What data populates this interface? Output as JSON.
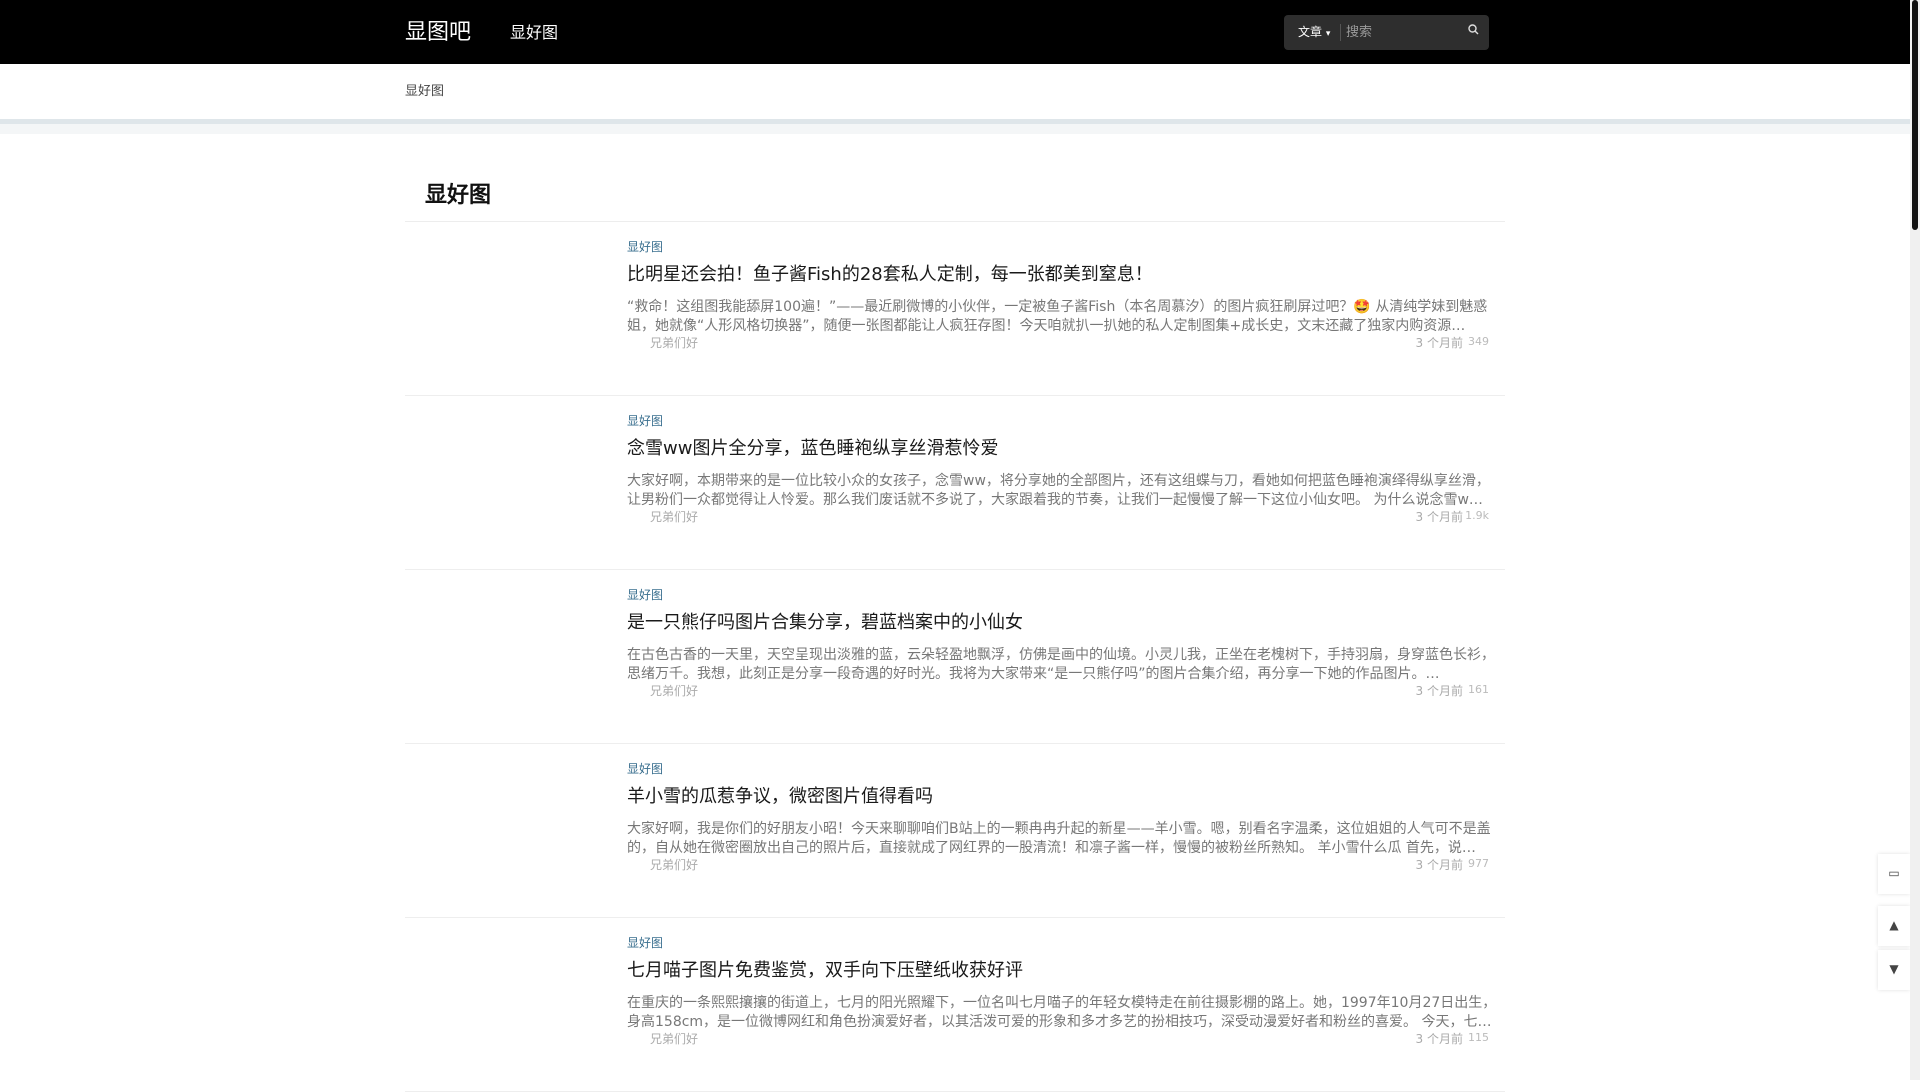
{
  "header": {
    "logo": "显图吧",
    "nav": [
      "显好图"
    ],
    "search": {
      "type_label": "文章",
      "type_icon": "chevron-down-icon",
      "placeholder": "搜索",
      "button_icon": "search-icon"
    }
  },
  "breadcrumb": "显好图",
  "section_title": "显好图",
  "posts": [
    {
      "category": "显好图",
      "title": "比明星还会拍！鱼子酱Fish的28套私人定制，每一张都美到窒息！",
      "excerpt": "“救命！这组图我能舔屏100遍！”——最近刷微博的小伙伴，一定被鱼子酱Fish（本名周慕汐）的图片疯狂刷屏过吧？🤩 从清纯学妹到魅惑姐，她就像“人形风格切换器”，随便一张图都能让人疯狂存图！今天咱就扒一扒她的私人定制图集+成长史，文末还藏了独家内购资源…",
      "author": "兄弟们好",
      "time": "3 个月前",
      "views": "349"
    },
    {
      "category": "显好图",
      "title": "念雪ww图片全分享，蓝色睡袍纵享丝滑惹怜爱",
      "excerpt": "大家好啊，本期带来的是一位比较小众的女孩子，念雪ww，将分享她的全部图片，还有这组蝶与刀，看她如何把蓝色睡袍演绎得纵享丝滑，让男粉们一众都觉得让人怜爱。那么我们废话就不多说了，大家跟着我的节奏，让我们一起慢慢了解一下这位小仙女吧。 为什么说念雪w…",
      "author": "兄弟们好",
      "time": "3 个月前",
      "views": "1.9k"
    },
    {
      "category": "显好图",
      "title": "是一只熊仔吗图片合集分享，碧蓝档案中的小仙女",
      "excerpt": "在古色古香的一天里，天空呈现出淡雅的蓝，云朵轻盈地飘浮，仿佛是画中的仙境。小灵儿我，正坐在老槐树下，手持羽扇，身穿蓝色长衫，思绪万千。我想，此刻正是分享一段奇遇的好时光。我将为大家带来“是一只熊仔吗”的图片合集介绍，再分享一下她的作品图片。…",
      "author": "兄弟们好",
      "time": "3 个月前",
      "views": "161"
    },
    {
      "category": "显好图",
      "title": "羊小雪的瓜惹争议，微密图片值得看吗",
      "excerpt": "大家好啊，我是你们的好朋友小昭！今天来聊聊咱们B站上的一颗冉冉升起的新星——羊小雪。嗯，别看名字温柔，这位姐姐的人气可不是盖的，自从她在微密圈放出自己的照片后，直接就成了网红界的一股清流！和凛子酱一样，慢慢的被粉丝所熟知。 羊小雪什么瓜 首先，说…",
      "author": "兄弟们好",
      "time": "3 个月前",
      "views": "977"
    },
    {
      "category": "显好图",
      "title": "七月喵子图片免费鉴赏，双手向下压壁纸收获好评",
      "excerpt": "在重庆的一条熙熙攘攘的街道上，七月的阳光照耀下，一位名叫七月喵子的年轻女模特走在前往摄影棚的路上。她，1997年10月27日出生，身高158cm，是一位微博网红和角色扮演爱好者，以其活泼可爱的形象和多才多艺的扮相技巧，深受动漫爱好者和粉丝的喜爱。 今天，七…",
      "author": "兄弟们好",
      "time": "3 个月前",
      "views": "115"
    }
  ],
  "float_buttons": [
    "chat-icon",
    "arrow-up-icon",
    "arrow-down-icon"
  ]
}
